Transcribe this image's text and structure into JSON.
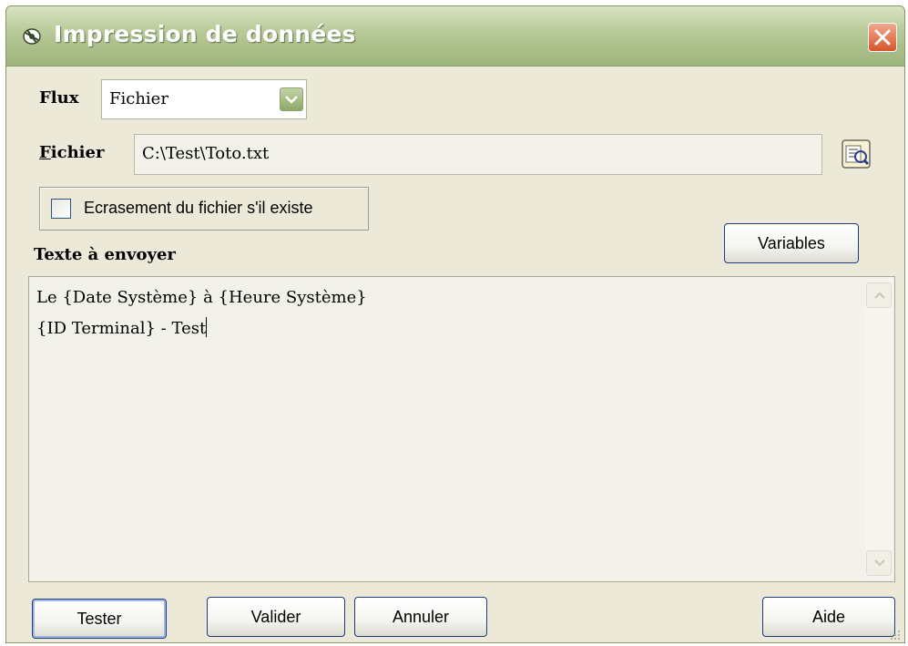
{
  "window": {
    "title": "Impression de données",
    "app_icon": "satellite-icon",
    "close_icon": "close-icon"
  },
  "flux": {
    "label": "Flux",
    "value": "Fichier",
    "dropdown_icon": "chevron-down-icon"
  },
  "fichier": {
    "label_first_letter": "F",
    "label_rest": "ichier",
    "value": "C:\\Test\\Toto.txt",
    "browse_icon": "browse-file-icon"
  },
  "overwrite": {
    "label": "Ecrasement du fichier s'il existe",
    "checked": false
  },
  "text_section": {
    "label": "Texte à envoyer",
    "variables_button": "Variables",
    "lines": [
      "Le {Date Système} à {Heure Système}",
      "{ID Terminal} - Test"
    ]
  },
  "buttons": {
    "tester": "Tester",
    "valider": "Valider",
    "annuler": "Annuler",
    "aide": "Aide"
  },
  "colors": {
    "titlebar": "#b6c896",
    "dialog_bg": "#ece9d8",
    "close_button": "#d9542c",
    "button_border": "#1f3b7a"
  }
}
